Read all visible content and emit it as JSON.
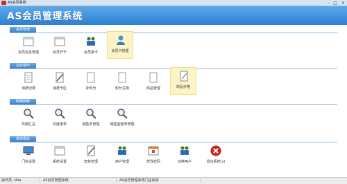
{
  "window": {
    "title": "AS会员系统",
    "controls": [
      "–",
      "□",
      "×"
    ]
  },
  "header": {
    "title": "AS会员管理系统"
  },
  "sections": [
    {
      "label": "会员管理",
      "items": [
        {
          "label": "会员信息管理"
        },
        {
          "label": "会员开卡"
        },
        {
          "label": "会员换卡"
        },
        {
          "label": "会员卡管理"
        }
      ]
    },
    {
      "label": "业务操作",
      "items": [
        {
          "label": "消费记录"
        },
        {
          "label": "消费卡区"
        },
        {
          "label": "补积分"
        },
        {
          "label": "积分兑换"
        },
        {
          "label": "商品管理"
        },
        {
          "label": "商品价格"
        }
      ]
    },
    {
      "label": "明细搜索",
      "items": [
        {
          "label": "日期汇总"
        },
        {
          "label": "月度报表"
        },
        {
          "label": "销售单管理"
        },
        {
          "label": "销售金额单管理"
        }
      ]
    },
    {
      "label": "系统相关",
      "items": [
        {
          "label": "门店设置"
        },
        {
          "label": "系统设置"
        },
        {
          "label": "角色管理"
        },
        {
          "label": "用户管理"
        },
        {
          "label": "修改密码"
        },
        {
          "label": "切换用户"
        },
        {
          "label": "退出系统(x)"
        }
      ]
    }
  ],
  "statusbar": {
    "operator": "操作员: shia",
    "system": "AS会员管理系统",
    "store": "AS会员管理系统门店系统"
  },
  "colors": {
    "header": "#2f7fd2",
    "tab": "#3b81cf",
    "selected": "#fdf4c6",
    "exit": "#d8261c"
  }
}
